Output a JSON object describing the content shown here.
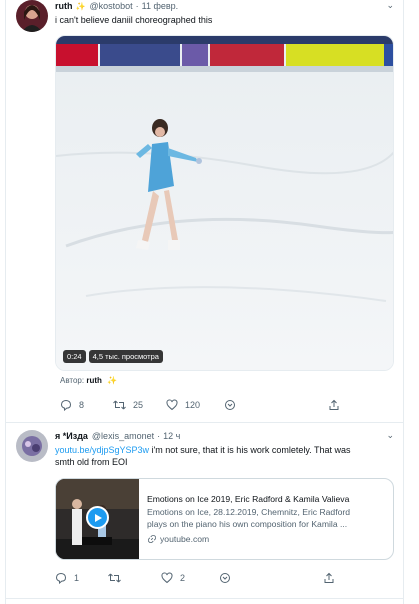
{
  "tweet1": {
    "name": "ruth",
    "handle": "@kostobot",
    "separator": "·",
    "date": "11 февр.",
    "text": "i can't believe daniil choreographed this",
    "video": {
      "duration": "0:24",
      "views": "4,5 тыс. просмотра"
    },
    "author_label": "Автор:",
    "author_name": "ruth",
    "actions": {
      "replies": "8",
      "retweets": "25",
      "likes": "120"
    }
  },
  "tweet2": {
    "name": "я *Изда",
    "handle": "@lexis_amonet",
    "separator": "·",
    "date": "12 ч",
    "link_text": "youtu.be/ydjpSgYSP3w",
    "text_rest": " i'm not sure, that it is his work comletely. That was",
    "text_line2": "smth old from EOI",
    "card": {
      "title": "Emotions on Ice 2019, Eric Radford & Kamila Valieva",
      "desc_line1": "Emotions on Ice, 28.12.2019, Chemnitz, Eric Radford",
      "desc_line2": "plays on the piano his own composition for Kamila ...",
      "domain": "youtube.com"
    },
    "actions": {
      "replies": "1",
      "retweets": "",
      "likes": "2"
    }
  },
  "icons": [
    "reply-icon",
    "retweet-icon",
    "like-icon",
    "share-icon",
    "play-icon",
    "link-icon",
    "more-caret-icon"
  ],
  "colors": {
    "accent": "#1d9bf0",
    "text": "#0f1419",
    "muted": "#536471",
    "border": "#e6ecf0"
  }
}
